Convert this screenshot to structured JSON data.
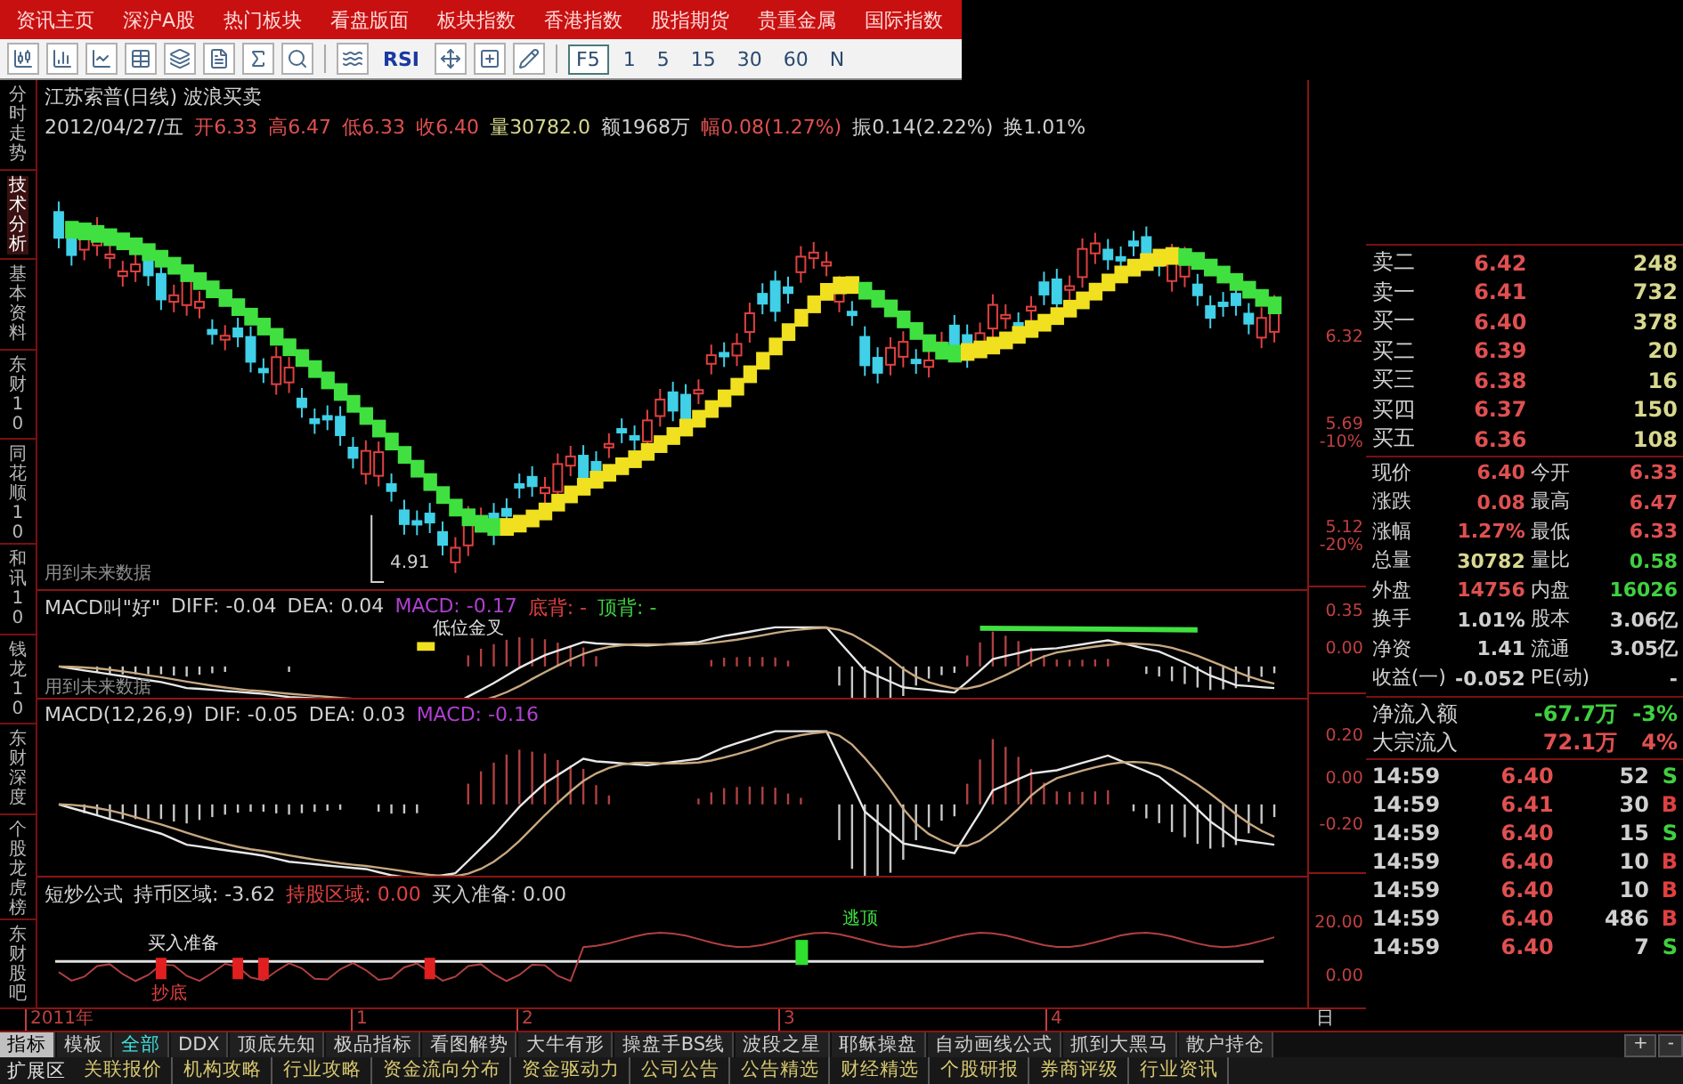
{
  "top_menu": [
    "资讯主页",
    "深沪A股",
    "热门板块",
    "看盘版面",
    "板块指数",
    "香港指数",
    "股指期货",
    "贵重金属",
    "国际指数"
  ],
  "toolbar": {
    "indicator_button": "RSI",
    "f5_button": "F5",
    "periods": [
      "1",
      "5",
      "15",
      "30",
      "60",
      "N"
    ]
  },
  "side_tabs": [
    {
      "label": "分时走势",
      "selected": false
    },
    {
      "label": "技术分析",
      "selected": true
    },
    {
      "label": "基本资料",
      "selected": false
    },
    {
      "label": "东财10",
      "selected": false
    },
    {
      "label": "同花顺10",
      "selected": false
    },
    {
      "label": "和讯10",
      "selected": false
    },
    {
      "label": "钱龙10",
      "selected": false
    },
    {
      "label": "东财深度",
      "selected": false
    },
    {
      "label": "个股龙虎榜",
      "selected": false
    },
    {
      "label": "东财股吧",
      "selected": false
    }
  ],
  "price_panel": {
    "title": "江苏索普(日线) 波浪买卖",
    "quote": [
      {
        "text": "2012/04/27/五",
        "color": "#d0d0d0"
      },
      {
        "text": "开6.33",
        "color": "#e05050"
      },
      {
        "text": "高6.47",
        "color": "#e05050"
      },
      {
        "text": "低6.33",
        "color": "#e05050"
      },
      {
        "text": "收6.40",
        "color": "#e05050"
      },
      {
        "text": "量30782.0",
        "color": "#d8d890"
      },
      {
        "text": "额1968万",
        "color": "#d0d0d0"
      },
      {
        "text": "幅0.08(1.27%)",
        "color": "#e05050"
      },
      {
        "text": "振0.14(2.22%)",
        "color": "#d0d0d0"
      },
      {
        "text": "换1.01%",
        "color": "#d0d0d0"
      }
    ],
    "low_label": "4.91",
    "note": "用到未来数据",
    "axis": [
      "6.32",
      "5.69",
      "-10%",
      "5.12",
      "-20%"
    ]
  },
  "macd_signal_panel": {
    "fields": [
      {
        "text": "MACD叫\"好\"",
        "color": "#d0d0d0"
      },
      {
        "text": "DIFF: -0.04",
        "color": "#d0d0d0"
      },
      {
        "text": "DEA: 0.04",
        "color": "#d0d0d0"
      },
      {
        "text": "MACD: -0.17",
        "color": "#b040d0"
      },
      {
        "text": "底背: -",
        "color": "#e04040"
      },
      {
        "text": "顶背: -",
        "color": "#40d040"
      }
    ],
    "signal_label": "低位金叉",
    "note": "用到未来数据",
    "axis": [
      "0.35",
      "0.00"
    ]
  },
  "macd_panel": {
    "fields": [
      {
        "text": "MACD(12,26,9)",
        "color": "#d0d0d0"
      },
      {
        "text": "DIF: -0.05",
        "color": "#d0d0d0"
      },
      {
        "text": "DEA: 0.03",
        "color": "#d0d0d0"
      },
      {
        "text": "MACD: -0.16",
        "color": "#b040d0"
      }
    ],
    "axis": [
      "0.20",
      "0.00",
      "-0.20"
    ]
  },
  "short_trade_panel": {
    "fields": [
      {
        "text": "短炒公式",
        "color": "#d0d0d0"
      },
      {
        "text": "持币区域: -3.62",
        "color": "#d0d0d0"
      },
      {
        "text": "持股区域: 0.00",
        "color": "#e04040"
      },
      {
        "text": "买入准备: 0.00",
        "color": "#d0d0d0"
      }
    ],
    "buy_label": "买入准备",
    "bottom_label": "抄底",
    "top_label": "逃顶",
    "axis": [
      "20.00",
      "0.00"
    ]
  },
  "x_axis": [
    "2011年",
    "1",
    "2",
    "3",
    "4"
  ],
  "period_label": "日",
  "order_book": [
    {
      "label": "卖二",
      "price": "6.42",
      "volume": "248"
    },
    {
      "label": "卖一",
      "price": "6.41",
      "volume": "732"
    },
    {
      "label": "买一",
      "price": "6.40",
      "volume": "378"
    },
    {
      "label": "买二",
      "price": "6.39",
      "volume": "20"
    },
    {
      "label": "买三",
      "price": "6.38",
      "volume": "16"
    },
    {
      "label": "买四",
      "price": "6.37",
      "volume": "150"
    },
    {
      "label": "买五",
      "price": "6.36",
      "volume": "108"
    }
  ],
  "quote_grid": [
    {
      "items": [
        {
          "label": "现价",
          "value": "6.40",
          "color": "#e05050"
        },
        {
          "label": "今开",
          "value": "6.33",
          "color": "#e05050"
        }
      ]
    },
    {
      "items": [
        {
          "label": "涨跌",
          "value": "0.08",
          "color": "#e05050"
        },
        {
          "label": "最高",
          "value": "6.47",
          "color": "#e05050"
        }
      ]
    },
    {
      "items": [
        {
          "label": "涨幅",
          "value": "1.27%",
          "color": "#e05050"
        },
        {
          "label": "最低",
          "value": "6.33",
          "color": "#e05050"
        }
      ]
    },
    {
      "items": [
        {
          "label": "总量",
          "value": "30782",
          "color": "#d8d890"
        },
        {
          "label": "量比",
          "value": "0.58",
          "color": "#40d040"
        }
      ]
    },
    {
      "items": [
        {
          "label": "外盘",
          "value": "14756",
          "color": "#e05050"
        },
        {
          "label": "内盘",
          "value": "16026",
          "color": "#40d040"
        }
      ]
    },
    {
      "items": [
        {
          "label": "换手",
          "value": "1.01%",
          "color": "#d0d0d0"
        },
        {
          "label": "股本",
          "value": "3.06亿",
          "color": "#d0d0d0"
        }
      ]
    },
    {
      "items": [
        {
          "label": "净资",
          "value": "1.41",
          "color": "#d0d0d0"
        },
        {
          "label": "流通",
          "value": "3.05亿",
          "color": "#d0d0d0"
        }
      ]
    },
    {
      "items": [
        {
          "label": "收益(一)",
          "value": "-0.052",
          "color": "#d0d0d0"
        },
        {
          "label": "PE(动)",
          "value": "-",
          "color": "#d0d0d0"
        }
      ]
    }
  ],
  "flows": [
    {
      "label": "净流入额",
      "value": "-67.7万",
      "percent": "-3%",
      "color": "#40d040"
    },
    {
      "label": "大宗流入",
      "value": "72.1万",
      "percent": "4%",
      "color": "#e05050"
    }
  ],
  "trades": [
    {
      "time": "14:59",
      "price": "6.40",
      "volume": "52",
      "side": "S",
      "color": "#40d040"
    },
    {
      "time": "14:59",
      "price": "6.41",
      "volume": "30",
      "side": "B",
      "color": "#e04040"
    },
    {
      "time": "14:59",
      "price": "6.40",
      "volume": "15",
      "side": "S",
      "color": "#40d040"
    },
    {
      "time": "14:59",
      "price": "6.40",
      "volume": "10",
      "side": "B",
      "color": "#e04040"
    },
    {
      "time": "14:59",
      "price": "6.40",
      "volume": "10",
      "side": "B",
      "color": "#e04040"
    },
    {
      "time": "14:59",
      "price": "6.40",
      "volume": "486",
      "side": "B",
      "color": "#e04040"
    },
    {
      "time": "14:59",
      "price": "6.40",
      "volume": "7",
      "side": "S",
      "color": "#40d040"
    }
  ],
  "indicator_tabs": [
    {
      "label": "指标",
      "selected": true,
      "highlighted": false
    },
    {
      "label": "模板",
      "selected": false,
      "highlighted": false
    },
    {
      "label": "全部",
      "selected": false,
      "highlighted": true
    },
    {
      "label": "DDX",
      "selected": false,
      "highlighted": false
    },
    {
      "label": "顶底先知",
      "selected": false,
      "highlighted": false
    },
    {
      "label": "极品指标",
      "selected": false,
      "highlighted": false
    },
    {
      "label": "看图解势",
      "selected": false,
      "highlighted": false
    },
    {
      "label": "大牛有形",
      "selected": false,
      "highlighted": false
    },
    {
      "label": "操盘手BS线",
      "selected": false,
      "highlighted": false
    },
    {
      "label": "波段之星",
      "selected": false,
      "highlighted": false
    },
    {
      "label": "耶稣操盘",
      "selected": false,
      "highlighted": false
    },
    {
      "label": "自动画线公式",
      "selected": false,
      "highlighted": false
    },
    {
      "label": "抓到大黑马",
      "selected": false,
      "highlighted": false
    },
    {
      "label": "散户持仓",
      "selected": false,
      "highlighted": false
    }
  ],
  "scroll_buttons": [
    "+",
    "-"
  ],
  "extension_label": "扩展区",
  "extension_tabs": [
    "关联报价",
    "机构攻略",
    "行业攻略",
    "资金流向分布",
    "资金驱动力",
    "公司公告",
    "公告精选",
    "财经精选",
    "个股研报",
    "券商评级",
    "行业资讯"
  ]
}
